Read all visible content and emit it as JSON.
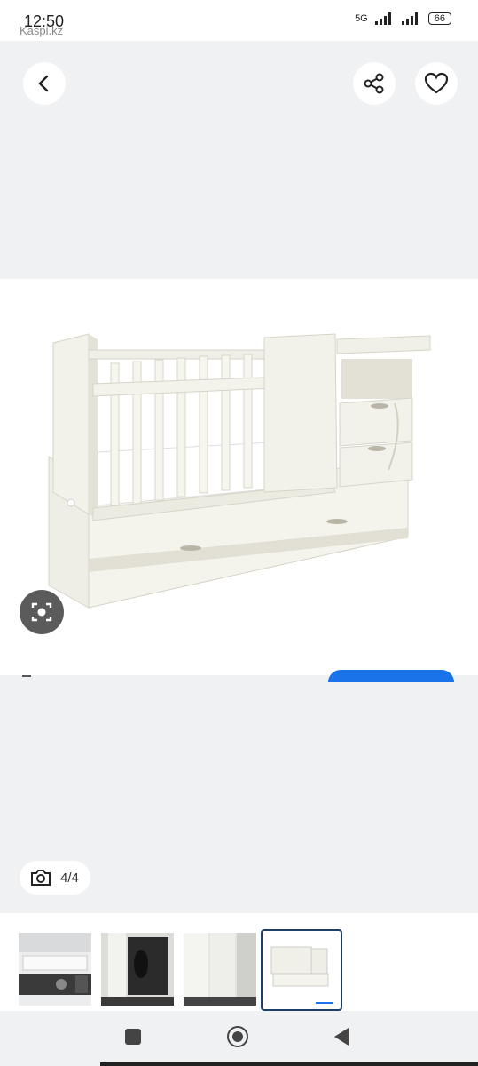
{
  "status_bar": {
    "time": "12:50",
    "app_label": "Kaspi.kz",
    "network": "5G",
    "battery": "66"
  },
  "gallery": {
    "counter": "4/4",
    "back_icon": "chevron-left-icon",
    "share_icon": "share-icon",
    "favorite_icon": "heart-icon",
    "lens_icon": "camera-search-icon",
    "counter_icon": "camera-icon"
  },
  "thumbnails": [
    {
      "label": "kitchen photo"
    },
    {
      "label": "closet photo"
    },
    {
      "label": "wardrobe photo"
    },
    {
      "label": "crib photo",
      "selected": true
    }
  ],
  "colors": {
    "accent": "#1a73e8",
    "selected_border": "#1c3f63",
    "background": "#f0f1f3"
  }
}
